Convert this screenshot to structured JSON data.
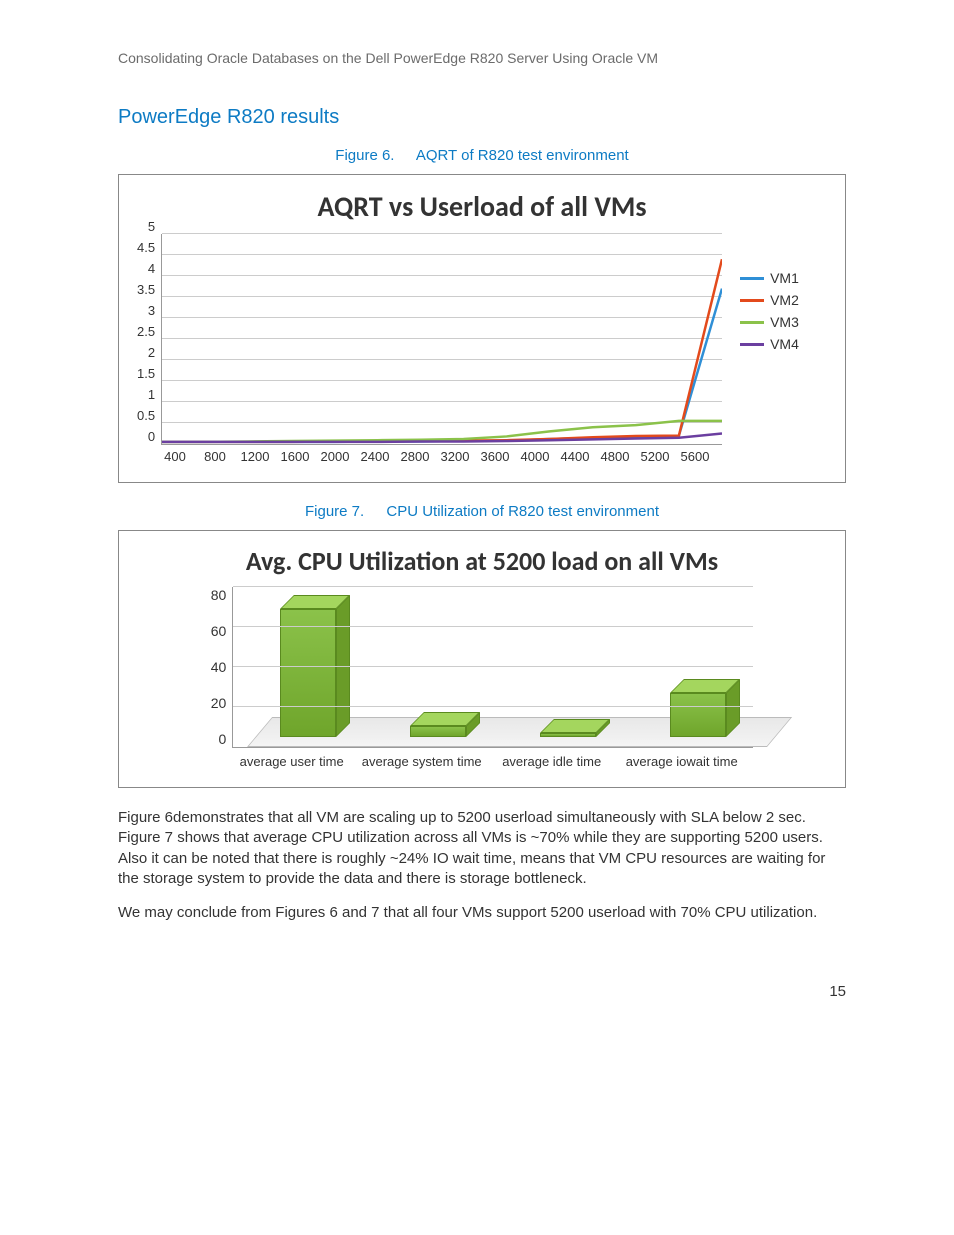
{
  "header": "Consolidating Oracle Databases on the Dell PowerEdge R820 Server Using Oracle VM",
  "section_title": "PowerEdge R820 results",
  "fig6": {
    "label": "Figure 6.",
    "caption": "AQRT of R820 test environment"
  },
  "fig7": {
    "label": "Figure 7.",
    "caption": "CPU Utilization of R820 test environment"
  },
  "para1": "Figure 6demonstrates that all VM are scaling up to 5200 userload simultaneously with SLA below 2 sec. Figure 7 shows that average CPU utilization across all VMs is ~70% while they are supporting 5200 users. Also it can be noted that there is roughly ~24% IO wait time, means that VM CPU resources are waiting for the storage system to provide the data and there is storage bottleneck.",
  "para2": "We may conclude from Figures 6 and 7 that all four VMs support 5200 userload with 70% CPU utilization.",
  "page_number": "15",
  "chart_data": [
    {
      "id": "aqrt",
      "type": "line",
      "title": "AQRT vs Userload of all VMs",
      "x": [
        400,
        800,
        1200,
        1600,
        2000,
        2400,
        2800,
        3200,
        3600,
        4000,
        4400,
        4800,
        5200,
        5600
      ],
      "ylim": [
        0,
        5
      ],
      "yticks": [
        0,
        0.5,
        1,
        1.5,
        2,
        2.5,
        3,
        3.5,
        4,
        4.5,
        5
      ],
      "series": [
        {
          "name": "VM1",
          "color": "#2f8fd6",
          "values": [
            0.05,
            0.05,
            0.05,
            0.05,
            0.05,
            0.06,
            0.06,
            0.07,
            0.08,
            0.12,
            0.15,
            0.18,
            0.2,
            3.7
          ]
        },
        {
          "name": "VM2",
          "color": "#e34a1c",
          "values": [
            0.05,
            0.05,
            0.05,
            0.05,
            0.06,
            0.06,
            0.07,
            0.08,
            0.09,
            0.12,
            0.16,
            0.19,
            0.2,
            4.4
          ]
        },
        {
          "name": "VM3",
          "color": "#8bc24a",
          "values": [
            0.05,
            0.05,
            0.06,
            0.07,
            0.08,
            0.09,
            0.1,
            0.12,
            0.18,
            0.3,
            0.4,
            0.45,
            0.55,
            0.55
          ]
        },
        {
          "name": "VM4",
          "color": "#6b3fa0",
          "values": [
            0.05,
            0.05,
            0.05,
            0.05,
            0.05,
            0.05,
            0.06,
            0.06,
            0.07,
            0.09,
            0.11,
            0.13,
            0.15,
            0.25
          ]
        }
      ]
    },
    {
      "id": "cpu",
      "type": "bar",
      "title": "Avg. CPU Utilization at 5200 load on all VMs",
      "categories": [
        "average user time",
        "average system time",
        "average idle time",
        "average iowait time"
      ],
      "values": [
        70,
        6,
        2,
        24
      ],
      "ylim": [
        0,
        80
      ],
      "yticks": [
        0,
        20,
        40,
        60,
        80
      ]
    }
  ]
}
